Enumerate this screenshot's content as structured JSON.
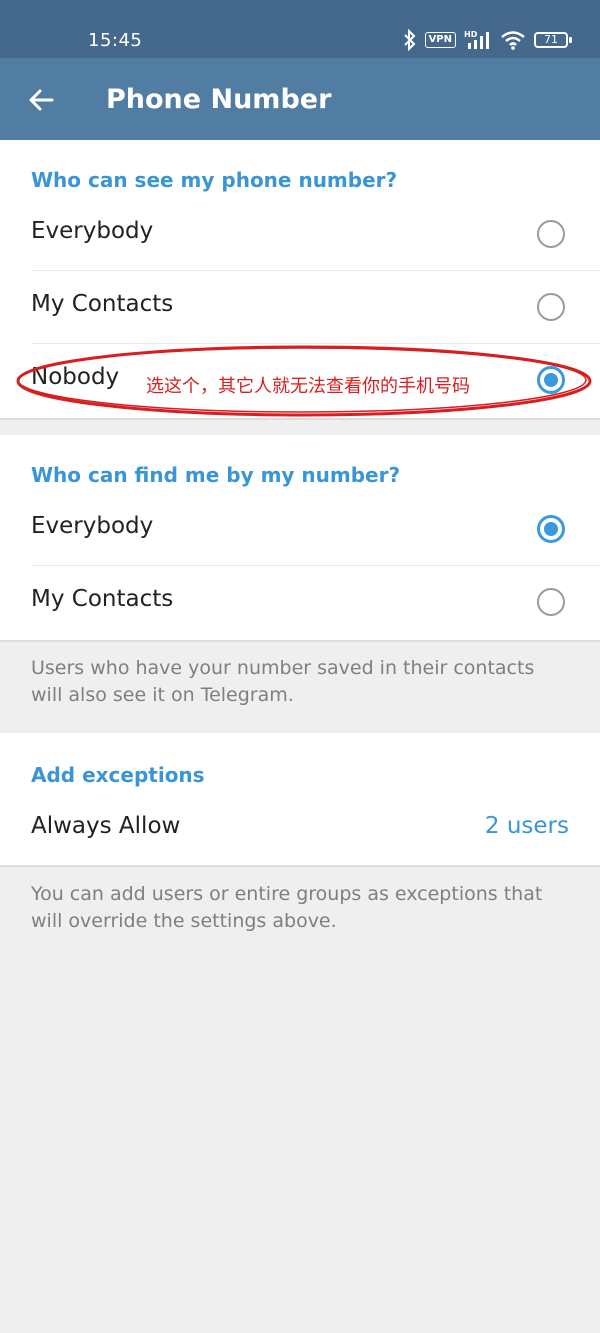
{
  "status": {
    "time": "15:45",
    "vpn": "VPN",
    "battery": "71",
    "icons": [
      "bluetooth-icon",
      "vpn-icon",
      "hd-signal-icon",
      "wifi-icon",
      "battery-icon"
    ]
  },
  "appbar": {
    "title": "Phone Number",
    "back_icon": "arrow-left-icon"
  },
  "see_section": {
    "header": "Who can see my phone number?",
    "options": [
      {
        "label": "Everybody",
        "checked": false
      },
      {
        "label": "My Contacts",
        "checked": false
      },
      {
        "label": "Nobody",
        "checked": true
      }
    ],
    "annotation": "选这个，其它人就无法查看你的手机号码"
  },
  "find_section": {
    "header": "Who can find me by my number?",
    "options": [
      {
        "label": "Everybody",
        "checked": true
      },
      {
        "label": "My Contacts",
        "checked": false
      }
    ],
    "note": "Users who have your number saved in their contacts will also see it on Telegram."
  },
  "exceptions": {
    "header": "Add exceptions",
    "always_allow_label": "Always Allow",
    "always_allow_value": "2 users",
    "note": "You can add users or entire groups as exceptions that will override the settings above."
  },
  "colors": {
    "statusbar": "#45698c",
    "appbar": "#527da3",
    "accent": "#3a95d5",
    "annotation": "#d81e1e"
  }
}
